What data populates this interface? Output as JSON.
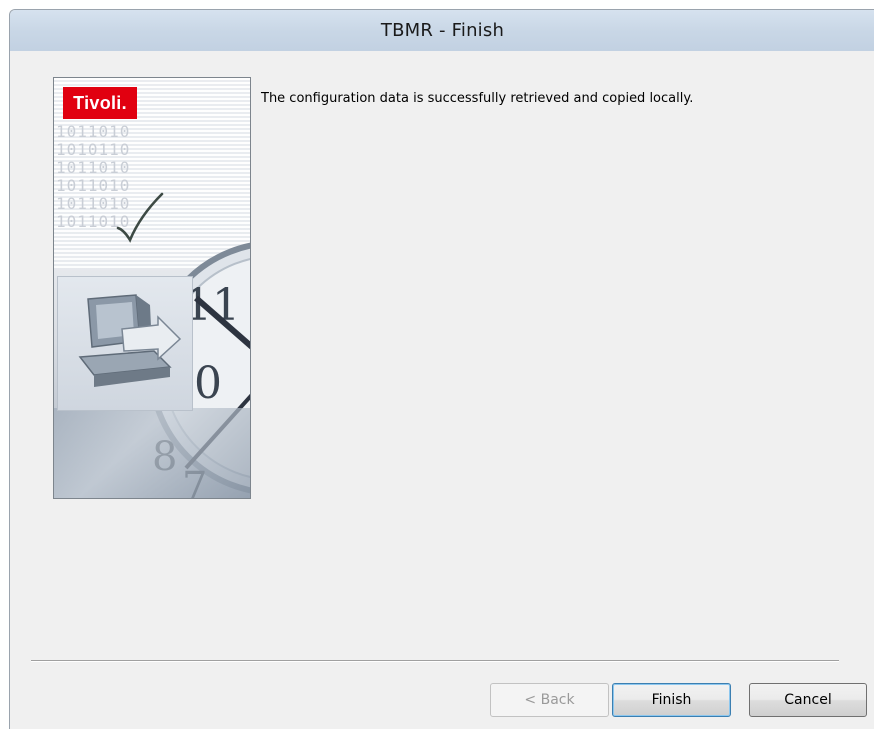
{
  "window": {
    "title": "TBMR - Finish"
  },
  "side_image": {
    "logo_text": "Tivoli.",
    "binary_rows": [
      "1011010",
      "1010110",
      "1011010",
      "1011010",
      "1011010",
      "1011010"
    ]
  },
  "content": {
    "message": "The configuration data is successfully retrieved and copied locally."
  },
  "buttons": {
    "back_label": "< Back",
    "back_enabled": false,
    "finish_label": "Finish",
    "cancel_label": "Cancel"
  },
  "colors": {
    "logo_red": "#e10010",
    "titlebar": "#c9d7e6",
    "dialog_bg": "#f0f0f0"
  }
}
